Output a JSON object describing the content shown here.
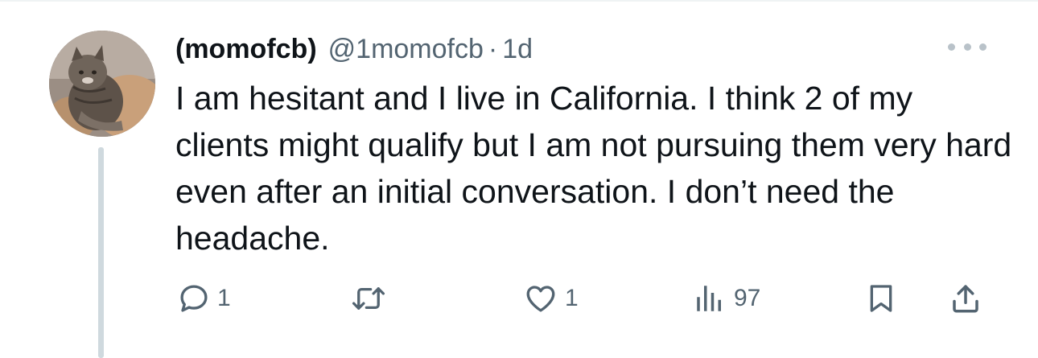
{
  "tweet": {
    "display_name": "(momofcb)",
    "handle": "@1momofcb",
    "separator": "·",
    "time": "1d",
    "text": "I am hesitant and I live in California. I think 2 of my clients might qualify but I am not pursuing them very hard even after an initial conversation. I don’t need the headache."
  },
  "actions": {
    "reply_count": "1",
    "like_count": "1",
    "views_count": "97"
  },
  "icons": {
    "reply": "reply-icon",
    "retweet": "retweet-icon",
    "like": "heart-icon",
    "views": "views-icon",
    "bookmark": "bookmark-icon",
    "share": "share-icon",
    "more": "more-icon"
  },
  "colors": {
    "text_primary": "#0f1419",
    "text_secondary": "#536471",
    "thread_line": "#cfd9de"
  }
}
